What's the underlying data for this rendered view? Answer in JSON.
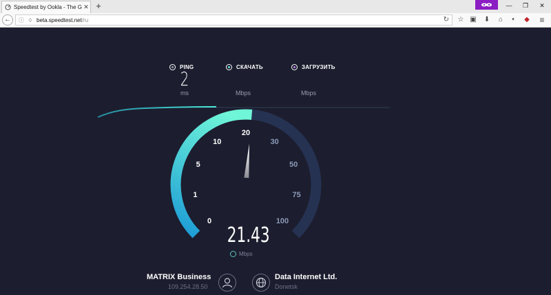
{
  "browser": {
    "tab_title": "Speedtest by Ookla - The Gl",
    "url_host": "beta.speedtest.net",
    "url_path": "/ru"
  },
  "metrics": {
    "ping": {
      "label": "PING",
      "value": "2",
      "unit": "ms"
    },
    "download": {
      "label": "СКАЧАТЬ",
      "unit": "Mbps"
    },
    "upload": {
      "label": "ЗАГРУЗИТЬ",
      "unit": "Mbps"
    }
  },
  "gauge": {
    "ticks": [
      "0",
      "1",
      "5",
      "10",
      "20",
      "30",
      "50",
      "75",
      "100"
    ],
    "current_value": "21.43",
    "needle_value": 21.43,
    "unit": "Mbps",
    "colors": {
      "active": "#2ed3ea",
      "inactive": "#263252",
      "active_label": "#ffffff",
      "inactive_label": "#8a9ab8"
    }
  },
  "connection": {
    "isp_name": "MATRIX Business",
    "isp_ip": "109.254.28.50",
    "server_name": "Data Internet Ltd.",
    "server_location": "Donetsk"
  },
  "icons": {
    "tab": "speedometer-icon",
    "private": "private-browsing-icon",
    "back": "back-arrow-icon",
    "info": "info-icon",
    "shield": "shield-icon",
    "reload": "reload-icon",
    "bookmark": "star-icon",
    "downloads": "download-icon",
    "home": "home-icon",
    "menu": "hamburger-menu-icon",
    "user": "user-icon",
    "globe": "globe-icon"
  }
}
